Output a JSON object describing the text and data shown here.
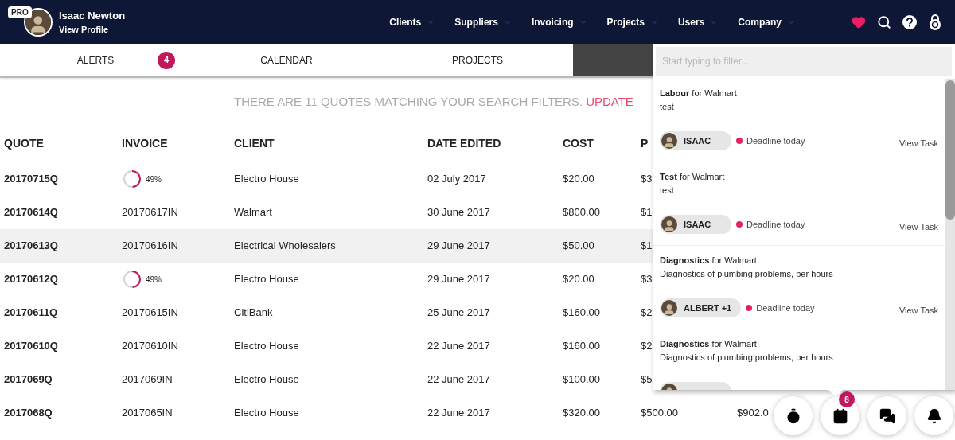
{
  "user": {
    "badge": "PRO",
    "name": "Isaac Newton",
    "link": "View Profile"
  },
  "nav": [
    {
      "label": "Clients"
    },
    {
      "label": "Suppliers"
    },
    {
      "label": "Invoicing"
    },
    {
      "label": "Projects"
    },
    {
      "label": "Users"
    },
    {
      "label": "Company"
    }
  ],
  "tabs": [
    {
      "label": "ALERTS",
      "badge": "4",
      "selected": false
    },
    {
      "label": "CALENDAR",
      "selected": false
    },
    {
      "label": "PROJECTS",
      "selected": false
    },
    {
      "selected": true
    }
  ],
  "message": {
    "text": "THERE ARE 11 QUOTES MATCHING YOUR SEARCH FILTERS.",
    "link": "UPDATE"
  },
  "table": {
    "columns": [
      "QUOTE",
      "INVOICE",
      "CLIENT",
      "DATE EDITED",
      "COST",
      "P"
    ],
    "rows": [
      {
        "selected": false,
        "quote": "20170715Q",
        "invoice": {
          "kind": "progress",
          "level": 0.49,
          "reading": "49%"
        },
        "client": "Electro House",
        "date": "02 July 2017",
        "cost": "$20.00",
        "column_6": "$3"
      },
      {
        "selected": false,
        "quote": "20170614Q",
        "invoice": {
          "kind": "text",
          "text": "20170617IN"
        },
        "client": "Walmart",
        "date": "30 June 2017",
        "cost": "$800.00",
        "column_6": "$1"
      },
      {
        "selected": true,
        "quote": "20170613Q",
        "invoice": {
          "kind": "text",
          "text": "20170616IN"
        },
        "client": "Electrical Wholesalers",
        "date": "29 June 2017",
        "cost": "$50.00",
        "column_6": "$1"
      },
      {
        "selected": false,
        "quote": "20170612Q",
        "invoice": {
          "kind": "progress",
          "level": 0.49,
          "reading": "49%"
        },
        "client": "Electro House",
        "date": "29 June 2017",
        "cost": "$20.00",
        "column_6": "$3"
      },
      {
        "selected": false,
        "quote": "20170611Q",
        "invoice": {
          "kind": "text",
          "text": "20170615IN"
        },
        "client": "CitiBank",
        "date": "25 June 2017",
        "cost": "$160.00",
        "column_6": "$2"
      },
      {
        "selected": false,
        "quote": "20170610Q",
        "invoice": {
          "kind": "text",
          "text": "20170610IN"
        },
        "client": "Electro House",
        "date": "22 June 2017",
        "cost": "$160.00",
        "column_6": "$2"
      },
      {
        "selected": false,
        "quote": "2017069Q",
        "invoice": {
          "kind": "text",
          "text": "2017069IN"
        },
        "client": "Electro House",
        "date": "22 June 2017",
        "cost": "$100.00",
        "column_6": "$5"
      },
      {
        "selected": false,
        "quote": "2017068Q",
        "invoice": {
          "kind": "text",
          "text": "2017065IN"
        },
        "client": "Electro House",
        "date": "22 June 2017",
        "cost": "$320.00",
        "column_6": "$500.00",
        "column_7": "$902.0"
      }
    ]
  },
  "tasks_panel": {
    "filter": {
      "placeholder": "Start typing to filter..."
    },
    "tasks": [
      {
        "title": "Labour",
        "client": "for Walmart",
        "description": "test",
        "assignee": "ISAAC",
        "deadline": "Deadline today",
        "action": "View Task"
      },
      {
        "title": "Test",
        "client": "for Walmart",
        "description": "test",
        "assignee": "ISAAC",
        "deadline": "Deadline today",
        "action": "View Task"
      },
      {
        "title": "Diagnostics",
        "client": "for Walmart",
        "description": "Diagnostics of plumbing problems, per hours",
        "assignee": "ALBERT +1",
        "deadline": "Deadline today",
        "action": "View Task"
      },
      {
        "title": "Diagnostics",
        "client": "for Walmart",
        "description": "Diagnostics of plumbing problems, per hours"
      }
    ]
  },
  "fab": [
    {
      "kind": "timer"
    },
    {
      "kind": "calendar",
      "badge": "8"
    },
    {
      "kind": "chat"
    },
    {
      "kind": "bell"
    }
  ]
}
